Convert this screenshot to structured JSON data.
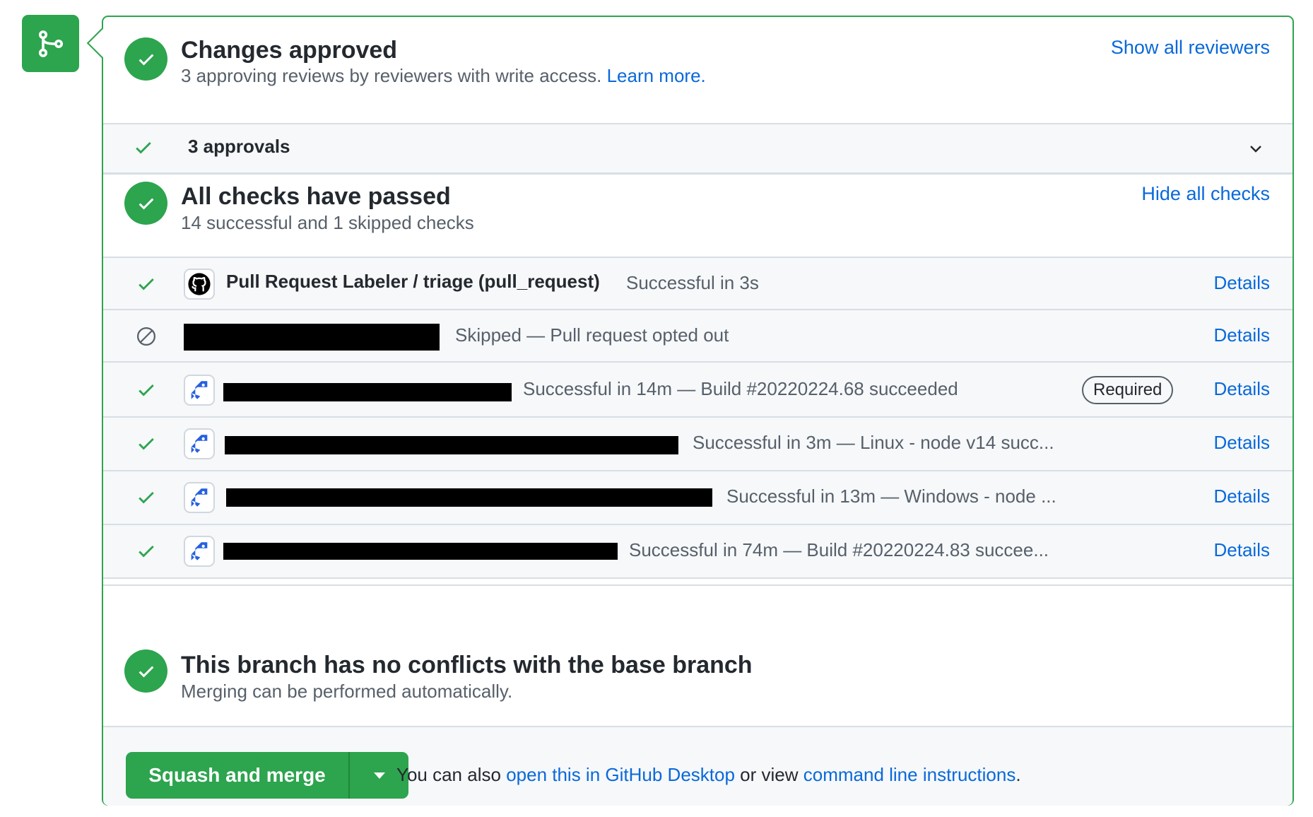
{
  "colors": {
    "success": "#2da44e",
    "link": "#0969da",
    "muted": "#57606a",
    "text": "#24292f",
    "border": "#d8dee4",
    "bg_subtle": "#f6f8fa"
  },
  "merge_icon": "git-merge-icon",
  "approval": {
    "title": "Changes approved",
    "subtitle": "3 approving reviews by reviewers with write access.",
    "learn_more": "Learn more.",
    "show_reviewers": "Show all reviewers",
    "approvals_label": "3 approvals"
  },
  "checks": {
    "title": "All checks have passed",
    "subtitle": "14 successful and 1 skipped checks",
    "hide_label": "Hide all checks",
    "details_label": "Details",
    "required_label": "Required",
    "rows": [
      {
        "status": "success",
        "icon": "github-icon",
        "name": "Pull Request Labeler / triage (pull_request)",
        "description": "Successful in 3s"
      },
      {
        "status": "skipped",
        "icon": "redacted",
        "name": "",
        "description": "Skipped — Pull request opted out"
      },
      {
        "status": "success",
        "icon": "azure-pipelines-icon",
        "name": "",
        "description": "Successful in 14m — Build #20220224.68 succeeded",
        "required": true
      },
      {
        "status": "success",
        "icon": "azure-pipelines-icon",
        "name": "",
        "description": "Successful in 3m — Linux - node v14 succ..."
      },
      {
        "status": "success",
        "icon": "azure-pipelines-icon",
        "name": "",
        "description": "Successful in 13m — Windows - node ..."
      },
      {
        "status": "success",
        "icon": "azure-pipelines-icon",
        "name": "",
        "description": "Successful in 74m — Build #20220224.83 succee..."
      }
    ]
  },
  "conflicts": {
    "title": "This branch has no conflicts with the base branch",
    "subtitle": "Merging can be performed automatically."
  },
  "merge": {
    "button_label": "Squash and merge",
    "note_prefix": "You can also",
    "desktop_link": "open this in GitHub Desktop",
    "note_middle": "or view",
    "cli_link": "command line instructions",
    "note_suffix": "."
  }
}
